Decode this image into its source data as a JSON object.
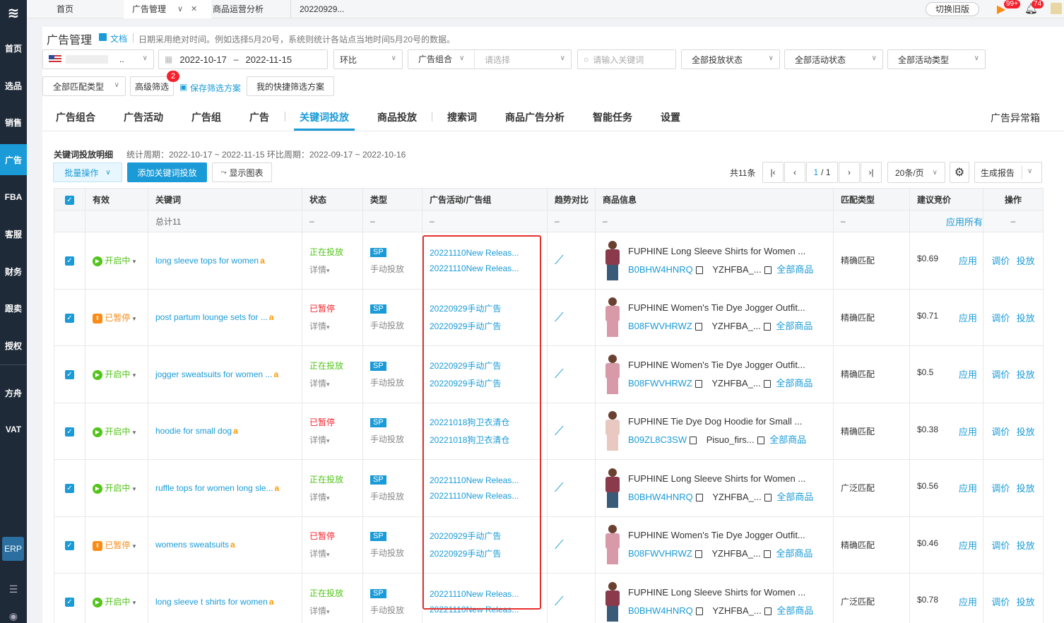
{
  "sidebar": {
    "logo": "≋",
    "items": [
      {
        "label": "首页",
        "active": false
      },
      {
        "label": "选品",
        "active": false
      },
      {
        "label": "销售",
        "active": false
      },
      {
        "label": "广告",
        "active": true
      },
      {
        "label": "FBA",
        "active": false
      },
      {
        "label": "客服",
        "active": false
      },
      {
        "label": "财务",
        "active": false
      },
      {
        "label": "跟卖",
        "active": false
      },
      {
        "label": "授权",
        "active": false
      },
      {
        "label": "方舟",
        "active": false
      },
      {
        "label": "VAT",
        "active": false
      }
    ],
    "erp": "ERP"
  },
  "topbar": {
    "tabs": [
      "首页",
      "广告管理",
      "商品运营分析",
      "20220929..."
    ],
    "switch_label": "切换旧版",
    "badge_a": "99+",
    "badge_b": "74"
  },
  "header": {
    "title": "广告管理",
    "doc": "文档",
    "notice": "日期采用绝对时间。例如选择5月20号，系统则统计各站点当地时间5月20号的数据。"
  },
  "filters": {
    "shop_suffix": "..",
    "date_start": "2022-10-17",
    "date_sep": "–",
    "date_end": "2022-11-15",
    "compare": "环比",
    "portfolio": "广告组合",
    "portfolio_ph": "请选择",
    "keyword_ph": "请输入关键词",
    "status_all": "全部投放状态",
    "activity_status": "全部活动状态",
    "activity_type": "全部活动类型",
    "match_type": "全部匹配类型",
    "advanced": "高级筛选",
    "advanced_badge": "2",
    "save_plan": "保存筛选方案",
    "my_plans": "我的快捷筛选方案"
  },
  "subtabs": [
    "广告组合",
    "广告活动",
    "广告组",
    "广告",
    "关键词投放",
    "商品投放",
    "搜索词",
    "商品广告分析",
    "智能任务",
    "设置"
  ],
  "subtab_active": "关键词投放",
  "ad_anomaly": "广告异常箱",
  "section": {
    "title": "关键词投放明细",
    "period": "统计周期：2022-10-17 ~ 2022-11-15 环比周期：2022-09-17 ~ 2022-10-16",
    "batch": "批量操作",
    "add": "添加关键词投放",
    "show_chart": "显示图表",
    "total_count": "共11条",
    "page_current": "1",
    "page_total": "/ 1",
    "page_size": "20条/页",
    "report": "生成报告"
  },
  "table": {
    "headers": [
      "有效",
      "关键词",
      "状态",
      "类型",
      "广告活动/广告组",
      "趋势对比",
      "商品信息",
      "匹配类型",
      "建议竞价",
      "操作"
    ],
    "total_row": {
      "label": "总计11",
      "dash": "–",
      "apply_all": "应用所有"
    },
    "detail": "详情",
    "manual": "手动投放",
    "apply": "应用",
    "adjust": "调价",
    "deliver": "投放",
    "all_products": "全部商品",
    "rows": [
      {
        "enabled": "开启中",
        "on": true,
        "keyword": "long sleeve tops for women",
        "status": "正在投放",
        "status_on": true,
        "type": "SP",
        "camp": "20221110New Releas...",
        "group": "20221110New Releas...",
        "ptitle": "FUPHINE Long Sleeve Shirts for Women ...",
        "asin": "B0BHW4HNRQ",
        "sku": "YZHFBA_...",
        "match": "精确匹配",
        "bid": "$0.69"
      },
      {
        "enabled": "已暂停",
        "on": false,
        "keyword": "post partum lounge sets for ...",
        "status": "已暂停",
        "status_on": false,
        "type": "SP",
        "camp": "20220929手动广告",
        "group": "20220929手动广告",
        "ptitle": "FUPHINE Women's Tie Dye Jogger Outfit...",
        "asin": "B08FWVHRWZ",
        "sku": "YZHFBA_...",
        "match": "精确匹配",
        "bid": "$0.71"
      },
      {
        "enabled": "开启中",
        "on": true,
        "keyword": "jogger sweatsuits for women ...",
        "status": "正在投放",
        "status_on": true,
        "type": "SP",
        "camp": "20220929手动广告",
        "group": "20220929手动广告",
        "ptitle": "FUPHINE Women's Tie Dye Jogger Outfit...",
        "asin": "B08FWVHRWZ",
        "sku": "YZHFBA_...",
        "match": "精确匹配",
        "bid": "$0.5"
      },
      {
        "enabled": "开启中",
        "on": true,
        "keyword": "hoodie for small dog",
        "status": "已暂停",
        "status_on": false,
        "type": "SP",
        "camp": "20221018狗卫衣清仓",
        "group": "20221018狗卫衣清仓",
        "ptitle": "FUPHINE Tie Dye Dog Hoodie for Small ...",
        "asin": "B09ZL8C3SW",
        "sku": "Pisuo_firs...",
        "match": "精确匹配",
        "bid": "$0.38"
      },
      {
        "enabled": "开启中",
        "on": true,
        "keyword": "ruffle tops for women long sle...",
        "status": "正在投放",
        "status_on": true,
        "type": "SP",
        "camp": "20221110New Releas...",
        "group": "20221110New Releas...",
        "ptitle": "FUPHINE Long Sleeve Shirts for Women ...",
        "asin": "B0BHW4HNRQ",
        "sku": "YZHFBA_...",
        "match": "广泛匹配",
        "bid": "$0.56"
      },
      {
        "enabled": "已暂停",
        "on": false,
        "keyword": "womens sweatsuits",
        "status": "已暂停",
        "status_on": false,
        "type": "SP",
        "camp": "20220929手动广告",
        "group": "20220929手动广告",
        "ptitle": "FUPHINE Women's Tie Dye Jogger Outfit...",
        "asin": "B08FWVHRWZ",
        "sku": "YZHFBA_...",
        "match": "精确匹配",
        "bid": "$0.46"
      },
      {
        "enabled": "开启中",
        "on": true,
        "keyword": "long sleeve t shirts for women",
        "status": "正在投放",
        "status_on": true,
        "type": "SP",
        "camp": "20221110New Releas...",
        "group": "20221110New Releas...",
        "ptitle": "FUPHINE Long Sleeve Shirts for Women ...",
        "asin": "B0BHW4HNRQ",
        "sku": "YZHFBA_...",
        "match": "广泛匹配",
        "bid": "$0.78"
      }
    ]
  }
}
